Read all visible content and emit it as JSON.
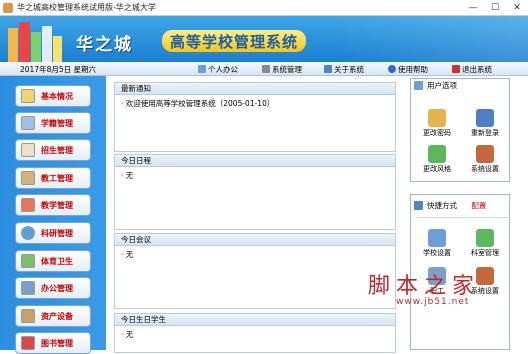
{
  "window": {
    "title": "华之城高校管理系统试用版-华之城大学",
    "minimize": "—",
    "maximize": "☐",
    "close": "✕"
  },
  "banner": {
    "name": "华之城",
    "system": "高等学校管理系统"
  },
  "toolbar": {
    "date": "2017年8月5日 星期六",
    "items": [
      "个人办公",
      "系统管理",
      "关于系统",
      "使用帮助",
      "退出系统"
    ]
  },
  "nav": {
    "items": [
      "基本情况",
      "学籍管理",
      "招生管理",
      "教工管理",
      "教学管理",
      "科研管理",
      "体育卫生",
      "办公管理",
      "资产设备",
      "图书管理"
    ]
  },
  "panels": [
    {
      "title": "最新通知",
      "body": "· 欢迎使用高等学校管理系统（2005-01-10）"
    },
    {
      "title": "今日日程",
      "body": "· 无"
    },
    {
      "title": "今日会议",
      "body": "· 无"
    },
    {
      "title": "今日生日学生",
      "body": "· 无"
    }
  ],
  "user_options": {
    "title": "用户选项",
    "items": [
      "更改密码",
      "重新登录",
      "更改风格",
      "系统设置"
    ]
  },
  "shortcuts": {
    "title": "快捷方式",
    "config": "配置",
    "items": [
      "学校设置",
      "科室管理",
      "职工",
      "系统设置"
    ]
  },
  "watermark": {
    "cn": "脚本之家",
    "url": "www.jb51.net"
  },
  "colors": {
    "banner": "#1a7fd0",
    "nav": "#2c8ee0",
    "nav_label": "#cc0000",
    "watermark": "#c4282b"
  }
}
